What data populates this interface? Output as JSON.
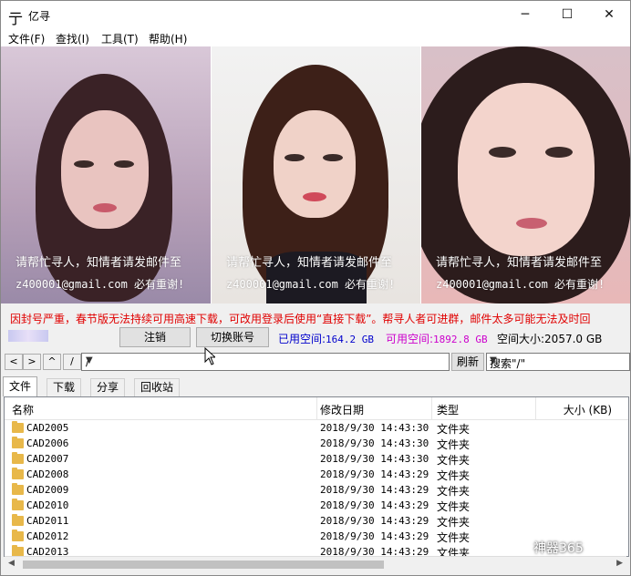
{
  "window": {
    "title": "亿寻",
    "app_icon": "亍",
    "minimize": "─",
    "maximize": "☐",
    "close": "✕"
  },
  "menu": [
    "文件(F)",
    "查找(I)",
    "工具(T)",
    "帮助(H)"
  ],
  "banner": {
    "message": "请帮忙寻人，知情者请发邮件至",
    "email_line": "z400001@gmail.com 必有重谢!"
  },
  "notice": "因封号严重，春节版无法持续可用高速下载，可改用登录后使用“直接下载”。帮寻人者可进群，邮件太多可能无法及时回",
  "status": {
    "logout_label": "注销",
    "switch_label": "切换账号",
    "used_label": "已用空间:",
    "used_value": "164.2 GB",
    "avail_label": "可用空间:",
    "avail_value": "1892.8 GB",
    "total_label": "空间大小:",
    "total_value": "2057.0 GB"
  },
  "nav": {
    "back": "<",
    "forward": ">",
    "up": "^",
    "root": "/",
    "path": "/",
    "refresh_label": "刷新",
    "search_value": "搜索\"/\""
  },
  "tabs": [
    "文件",
    "下载",
    "分享",
    "回收站"
  ],
  "columns": {
    "name": "名称",
    "modified": "修改日期",
    "type": "类型",
    "size": "大小 (KB)"
  },
  "rows": [
    {
      "name": "CAD2005",
      "date": "2018/9/30 14:43:30",
      "type": "文件夹"
    },
    {
      "name": "CAD2006",
      "date": "2018/9/30 14:43:30",
      "type": "文件夹"
    },
    {
      "name": "CAD2007",
      "date": "2018/9/30 14:43:30",
      "type": "文件夹"
    },
    {
      "name": "CAD2008",
      "date": "2018/9/30 14:43:29",
      "type": "文件夹"
    },
    {
      "name": "CAD2009",
      "date": "2018/9/30 14:43:29",
      "type": "文件夹"
    },
    {
      "name": "CAD2010",
      "date": "2018/9/30 14:43:29",
      "type": "文件夹"
    },
    {
      "name": "CAD2011",
      "date": "2018/9/30 14:43:29",
      "type": "文件夹"
    },
    {
      "name": "CAD2012",
      "date": "2018/9/30 14:43:29",
      "type": "文件夹"
    },
    {
      "name": "CAD2013",
      "date": "2018/9/30 14:43:29",
      "type": "文件夹"
    }
  ],
  "watermark": "神器365",
  "colors": {
    "notice": "#e00000",
    "used": "#0000cc",
    "avail": "#cc00cc",
    "folder": "#e8b84a"
  }
}
